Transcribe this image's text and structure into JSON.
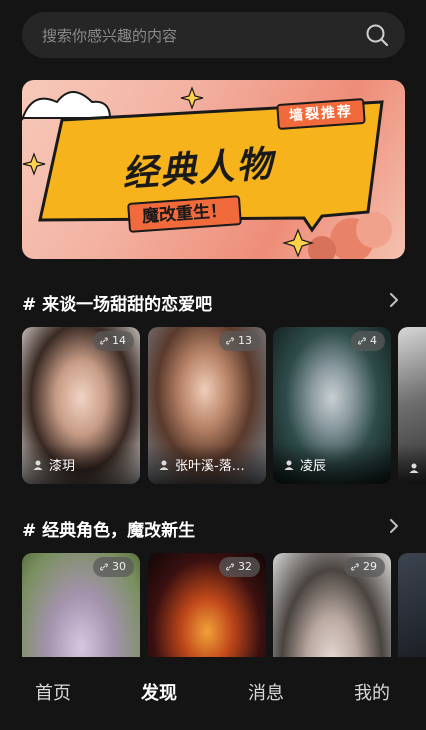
{
  "search": {
    "placeholder": "搜索你感兴趣的内容"
  },
  "banner": {
    "tag": "墙裂推荐",
    "title": "经典人物",
    "subtitle": "魔改重生！"
  },
  "sections": [
    {
      "title": "# 来谈一场甜甜的恋爱吧",
      "cards": [
        {
          "name": "漆玥",
          "count": "14"
        },
        {
          "name": "张叶溪-落…",
          "count": "13"
        },
        {
          "name": "凌辰",
          "count": "4"
        },
        {
          "name": "",
          "count": ""
        }
      ]
    },
    {
      "title": "# 经典角色，魔改新生",
      "cards": [
        {
          "name": "",
          "count": "30"
        },
        {
          "name": "",
          "count": "32"
        },
        {
          "name": "",
          "count": "29"
        },
        {
          "name": "",
          "count": ""
        }
      ]
    }
  ],
  "nav": {
    "items": [
      {
        "label": "首页"
      },
      {
        "label": "发现"
      },
      {
        "label": "消息"
      },
      {
        "label": "我的"
      }
    ],
    "active": "发现"
  }
}
